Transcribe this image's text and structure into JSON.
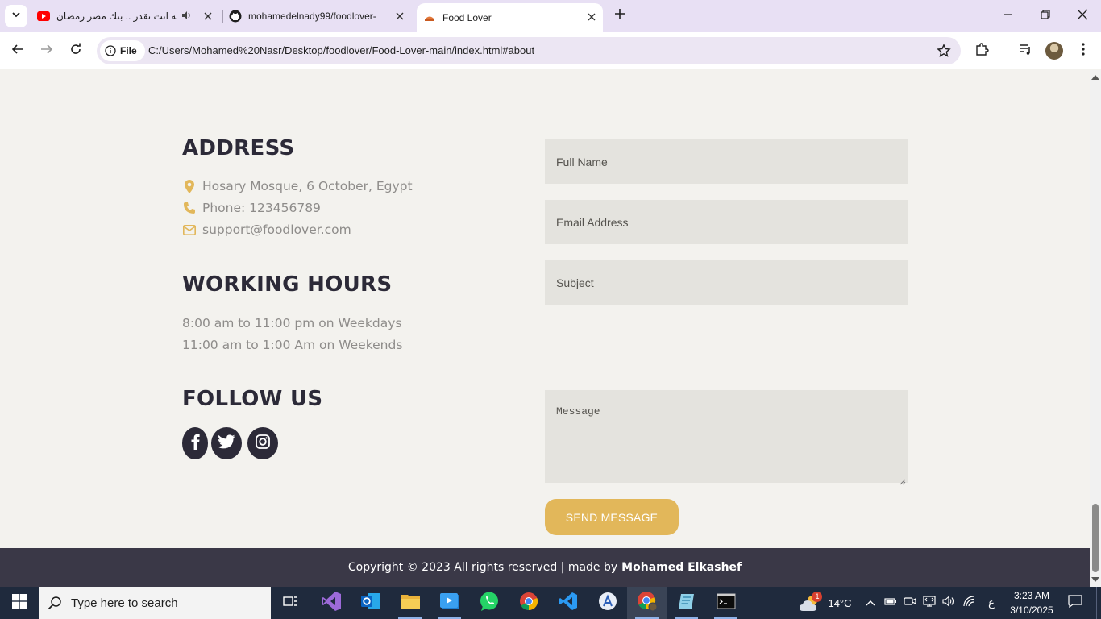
{
  "browser": {
    "tabs": [
      {
        "title": "اغنيه انت تقدر .. بنك مصر رمضان",
        "favicon": "youtube-icon",
        "audio": true
      },
      {
        "title": "mohamedelnady99/foodlover-",
        "favicon": "github-icon"
      },
      {
        "title": "Food Lover",
        "favicon": "foodlover-icon",
        "active": true
      }
    ],
    "file_label": "File",
    "url": "C:/Users/Mohamed%20Nasr/Desktop/foodlover/Food-Lover-main/index.html#about"
  },
  "contact": {
    "address_title": "ADDRESS",
    "address": "Hosary Mosque, 6 October, Egypt",
    "phone": "Phone: 123456789",
    "email": "support@foodlover.com",
    "hours_title": "WORKING HOURS",
    "hours_weekdays": "8:00 am to 11:00 pm on Weekdays",
    "hours_weekends": "11:00 am to 1:00 Am on Weekends",
    "follow_title": "FOLLOW US",
    "socials": [
      "facebook-icon",
      "twitter-icon",
      "instagram-icon"
    ]
  },
  "form": {
    "name_placeholder": "Full Name",
    "email_placeholder": "Email Address",
    "subject_placeholder": "Subject",
    "message_placeholder": "Message",
    "send_label": "SEND MESSAGE"
  },
  "footer": {
    "text": "Copyright © 2023 All rights reserved | made by",
    "author": "Mohamed Elkashef"
  },
  "taskbar": {
    "search_placeholder": "Type here to search",
    "temperature": "14°C",
    "weather_badge": "1",
    "language": "ع",
    "time": "3:23 AM",
    "date": "3/10/2025"
  },
  "colors": {
    "accent": "#e2b75a",
    "heading": "#2c2a38",
    "footer_bg": "#3a3847",
    "page_bg": "#f3f2ee"
  }
}
